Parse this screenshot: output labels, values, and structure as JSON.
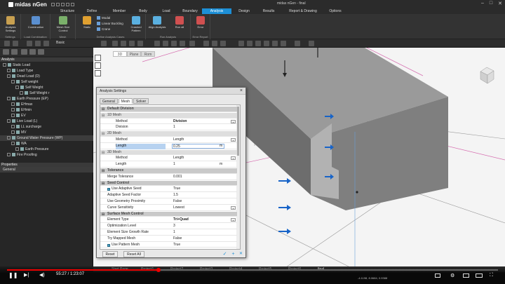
{
  "app": {
    "name": "midas nGen",
    "window_title": "midas nGen - final"
  },
  "menu": {
    "tabs": [
      "Structure",
      "Define",
      "Member",
      "Body",
      "Load",
      "Boundary",
      "Analysis",
      "Design",
      "Results",
      "Report & Drawing",
      "Options"
    ],
    "active": "Analysis"
  },
  "ribbon": {
    "groups": [
      {
        "label": "Settings",
        "buttons": [
          "Analysis Settings"
        ]
      },
      {
        "label": "Load Combination",
        "buttons": [
          "Combination"
        ]
      },
      {
        "label": "Mesh",
        "buttons": [
          "Mesh Size Control"
        ]
      },
      {
        "label": "Define Analysis Cases",
        "buttons": [
          "Static",
          "Crashed Pattern"
        ],
        "small": [
          "Modal",
          "Linear Buckling",
          "Crane"
        ]
      },
      {
        "label": "Run Analysis",
        "buttons": [
          "Align Analysis",
          "Run all"
        ]
      },
      {
        "label": "Error Report",
        "buttons": [
          "Error"
        ]
      }
    ]
  },
  "toolbar": {
    "mode": "Basic"
  },
  "left_panel": {
    "title": "Analysis",
    "tree": [
      "Static Load",
      "Load Type",
      "Dead Load (D)",
      "Self weight",
      "Self Weight",
      "Self Weight r",
      "Earth Pressure (EP)",
      "EHmax",
      "EHmin",
      "EV",
      "Live Load (L)",
      "LL surcharge",
      "MV",
      "Ground Water Pressure (WP)",
      "WA",
      "Earth Pressure",
      "Fire Proofing"
    ],
    "properties_title": "Properties",
    "properties_item": "General"
  },
  "viewport": {
    "tabs": [
      "3D",
      "Plane",
      "Rom"
    ],
    "status": "-4.1198, 8.0684, 0.9388"
  },
  "dialog": {
    "title": "Analysis Settings",
    "tabs": [
      "General",
      "Mesh",
      "Solver"
    ],
    "active_tab": "Mesh",
    "rows": [
      {
        "type": "cat",
        "label": "Default Division"
      },
      {
        "type": "sub",
        "label": "1D Mesh"
      },
      {
        "type": "prop",
        "key": "Method",
        "value": "Division",
        "dd": true,
        "bold": true
      },
      {
        "type": "prop",
        "key": "Division",
        "value": "1"
      },
      {
        "type": "sub",
        "label": "2D Mesh"
      },
      {
        "type": "prop",
        "key": "Method",
        "value": "Length",
        "dd": true
      },
      {
        "type": "prop",
        "key": "Length",
        "value": "0.25",
        "unit": "m",
        "selected": true
      },
      {
        "type": "sub",
        "label": "3D Mesh"
      },
      {
        "type": "prop",
        "key": "Method",
        "value": "Length",
        "dd": true
      },
      {
        "type": "prop",
        "key": "Length",
        "value": "1",
        "unit": "m"
      },
      {
        "type": "cat",
        "label": "Tolerance"
      },
      {
        "type": "prop",
        "key": "Merge Tolerance",
        "value": "0.001",
        "flush": true
      },
      {
        "type": "cat",
        "label": "Seed Control"
      },
      {
        "type": "prop",
        "key": "Use Adaptive Seed",
        "value": "True",
        "cb": true,
        "flush": true
      },
      {
        "type": "prop",
        "key": "Adaptive Seed Factor",
        "value": "1.5",
        "flush": true
      },
      {
        "type": "prop",
        "key": "Use Geometry Proximity",
        "value": "False",
        "flush": true
      },
      {
        "type": "prop",
        "key": "Curve Sensitivity",
        "value": "Lowest",
        "dd": true,
        "flush": true
      },
      {
        "type": "cat",
        "label": "Surface Mesh Control"
      },
      {
        "type": "prop",
        "key": "Element Type",
        "value": "Tri+Quad",
        "dd": true,
        "flush": true,
        "bold": true
      },
      {
        "type": "prop",
        "key": "Optimization Level",
        "value": "3",
        "flush": true
      },
      {
        "type": "prop",
        "key": "Element Size Growth Rate",
        "value": "1",
        "flush": true
      },
      {
        "type": "prop",
        "key": "Try Mapped Mesh",
        "value": "False",
        "flush": true
      },
      {
        "type": "prop",
        "key": "Use Pattern Mesh",
        "value": "True",
        "cb": true,
        "flush": true
      }
    ],
    "buttons": {
      "reset": "Reset",
      "reset_all": "Reset All",
      "ok": "✓",
      "add": "+",
      "cancel": "✕"
    }
  },
  "taskbar": {
    "tabs": [
      "Start Page",
      "Project1",
      "Project2",
      "Project3",
      "Project4",
      "Project5",
      "Project6",
      "final"
    ]
  },
  "player": {
    "progress": 0.311,
    "time": "55:27 / 1:23:07"
  },
  "colors": {
    "accent": "#1d8fd6",
    "progress": "#ee0000"
  }
}
